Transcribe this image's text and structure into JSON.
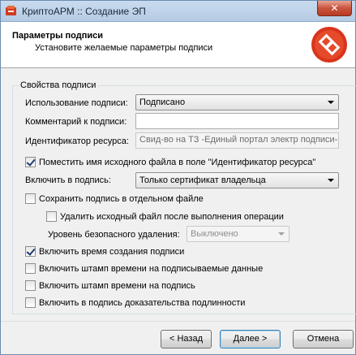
{
  "window": {
    "title": "КриптоАРМ :: Создание ЭП",
    "close_symbol": "✕"
  },
  "header": {
    "title": "Параметры подписи",
    "subtitle": "Установите желаемые параметры подписи",
    "logo_icon": "cryptoarm-logo-icon"
  },
  "group": {
    "title": "Свойства подписи",
    "usage_label": "Использование подписи:",
    "usage_value": "Подписано",
    "comment_label": "Комментарий к подписи:",
    "comment_value": "",
    "resource_label": "Идентификатор ресурса:",
    "resource_value": "Свид-во на ТЗ -Единый портал электр подписи-",
    "put_filename_label": "Поместить имя исходного файла в поле \"Идентификатор ресурса\"",
    "put_filename_checked": true,
    "include_label": "Включить в подпись:",
    "include_value": "Только сертификат владельца",
    "save_separate_label": "Сохранить подпись в отдельном файле",
    "save_separate_checked": false,
    "delete_source_label": "Удалить исходный файл после выполнения операции",
    "delete_source_checked": false,
    "secure_delete_label": "Уровень безопасного удаления:",
    "secure_delete_value": "Выключено",
    "include_time_label": "Включить время создания подписи",
    "include_time_checked": true,
    "timestamp_data_label": "Включить штамп времени на подписываемые данные",
    "timestamp_data_checked": false,
    "timestamp_sig_label": "Включить штамп времени на подпись",
    "timestamp_sig_checked": false,
    "evidence_label": "Включить в подпись доказательства подлинности",
    "evidence_checked": false
  },
  "buttons": {
    "back": "< Назад",
    "next": "Далее >",
    "cancel": "Отмена"
  }
}
